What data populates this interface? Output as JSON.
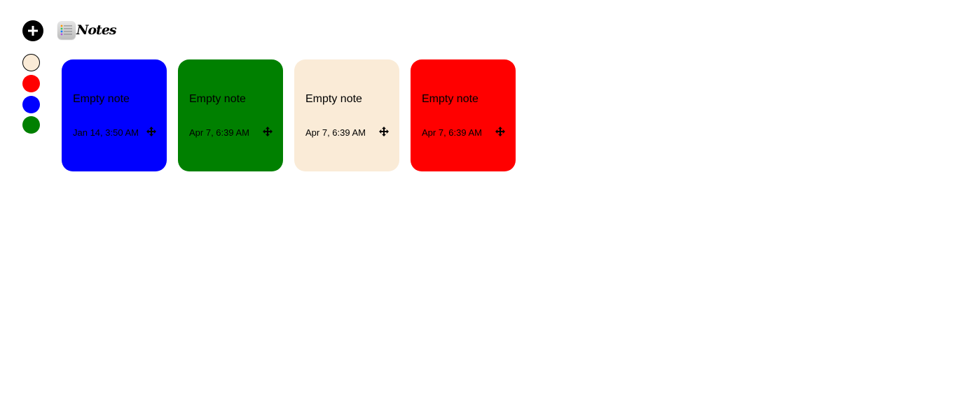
{
  "app": {
    "title": "Notes"
  },
  "toolbar": {
    "add_icon": "plus-icon",
    "add_color": "#000000"
  },
  "palette": [
    {
      "name": "beige",
      "color": "#faebd7",
      "bordered": true
    },
    {
      "name": "red",
      "color": "#ff0000",
      "bordered": false
    },
    {
      "name": "blue",
      "color": "#0000ff",
      "bordered": false
    },
    {
      "name": "green",
      "color": "#008000",
      "bordered": false
    }
  ],
  "notes": [
    {
      "text": "Empty note",
      "date": "Jan 14, 3:50 AM",
      "color": "#0000ff",
      "handle_icon": "move-icon"
    },
    {
      "text": "Empty note",
      "date": "Apr 7, 6:39 AM",
      "color": "#008000",
      "handle_icon": "move-icon"
    },
    {
      "text": "Empty note",
      "date": "Apr 7, 6:39 AM",
      "color": "#faebd7",
      "handle_icon": "move-icon"
    },
    {
      "text": "Empty note",
      "date": "Apr 7, 6:39 AM",
      "color": "#ff0000",
      "handle_icon": "move-icon"
    }
  ]
}
